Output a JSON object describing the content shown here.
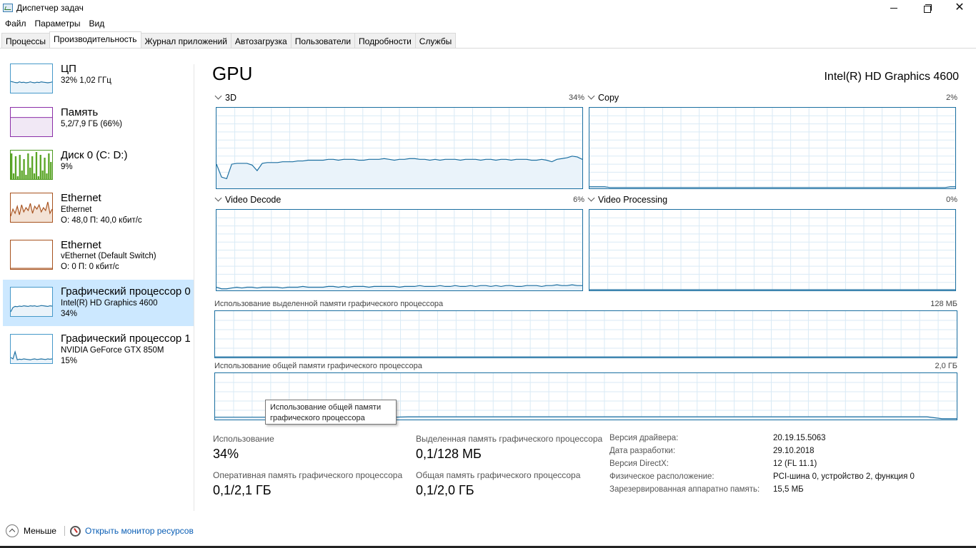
{
  "window": {
    "title": "Диспетчер задач",
    "minimize": "",
    "maximize": "",
    "close": "✕"
  },
  "menu": [
    "Файл",
    "Параметры",
    "Вид"
  ],
  "tabs": [
    "Процессы",
    "Производительность",
    "Журнал приложений",
    "Автозагрузка",
    "Пользователи",
    "Подробности",
    "Службы"
  ],
  "active_tab": "Производительность",
  "sidebar": [
    {
      "title": "ЦП",
      "line1": "32% 1,02 ГГц",
      "line2": "",
      "color": "#1a6ea0",
      "fill": "#eaf3fa"
    },
    {
      "title": "Память",
      "line1": "5,2/7,9 ГБ (66%)",
      "line2": "",
      "color": "#8b2fa8",
      "fill": "#f1e8f5",
      "level": 0.66
    },
    {
      "title": "Диск 0 (C: D:)",
      "line1": "9%",
      "line2": "",
      "color": "#4d9a1e",
      "fill": "#5aa526"
    },
    {
      "title": "Ethernet",
      "line1": "Ethernet",
      "line2": "О: 48,0  П: 40,0 кбит/с",
      "color": "#a7521e",
      "fill": "#f3e2d5"
    },
    {
      "title": "Ethernet",
      "line1": "vEthernet (Default Switch)",
      "line2": "О: 0  П: 0 кбит/с",
      "color": "#a7521e",
      "fill": "#ffffff"
    },
    {
      "title": "Графический процессор 0",
      "line1": "Intel(R) HD Graphics 4600",
      "line2": "34%",
      "color": "#1a6ea0",
      "fill": "#eaf3fa",
      "selected": true
    },
    {
      "title": "Графический процессор 1",
      "line1": "NVIDIA GeForce GTX 850M",
      "line2": "15%",
      "color": "#1a6ea0",
      "fill": "#eaf3fa"
    }
  ],
  "main": {
    "title": "GPU",
    "device": "Intel(R) HD Graphics 4600",
    "engines": [
      {
        "name": "3D",
        "percent": "34%",
        "values": [
          30,
          14,
          12,
          30,
          31,
          31,
          31,
          29,
          22,
          31,
          32,
          32,
          32,
          33,
          33,
          33,
          34,
          34,
          35,
          35,
          35,
          35,
          36,
          36,
          35,
          36,
          36,
          36,
          35,
          35,
          36,
          36,
          36,
          37,
          36,
          35,
          36,
          36,
          37,
          37,
          36,
          36,
          35,
          36,
          35,
          36,
          36,
          36,
          35,
          36,
          36,
          36,
          35,
          36,
          36,
          35,
          36,
          36,
          35,
          36,
          36,
          36,
          35,
          35,
          36,
          35,
          33,
          36,
          37,
          38,
          40,
          39,
          36
        ]
      },
      {
        "name": "Copy",
        "percent": "2%",
        "values": [
          2,
          2,
          2,
          2,
          1,
          1,
          1,
          1,
          1,
          1,
          1,
          1,
          1,
          1,
          1,
          1,
          1,
          1,
          1,
          1,
          1,
          1,
          1,
          1,
          1,
          1,
          1,
          1,
          1,
          1,
          1,
          1,
          1,
          1,
          1,
          1,
          1,
          1,
          1,
          1,
          1,
          1,
          1,
          1,
          1,
          1,
          1,
          1,
          1,
          1,
          1,
          1,
          1,
          1,
          1,
          1,
          1,
          1,
          1,
          1,
          1,
          1,
          1,
          1,
          1,
          1,
          1,
          1,
          1,
          1,
          1,
          2,
          2
        ]
      },
      {
        "name": "Video Decode",
        "percent": "6%",
        "values": [
          4,
          2,
          2,
          3,
          4,
          3,
          4,
          4,
          3,
          4,
          4,
          4,
          4,
          3,
          4,
          4,
          4,
          5,
          4,
          4,
          4,
          4,
          5,
          5,
          4,
          5,
          4,
          5,
          5,
          5,
          4,
          5,
          5,
          5,
          5,
          5,
          4,
          5,
          5,
          5,
          6,
          5,
          5,
          5,
          6,
          5,
          5,
          6,
          5,
          5,
          6,
          5,
          6,
          6,
          5,
          6,
          5,
          6,
          6,
          5,
          5,
          6,
          6,
          6,
          5,
          6,
          6,
          7,
          6,
          6,
          7,
          6,
          6
        ]
      },
      {
        "name": "Video Processing",
        "percent": "0%",
        "values": [
          0,
          0,
          0,
          0,
          0,
          0,
          0,
          0,
          0,
          0,
          0,
          0,
          0,
          0,
          0,
          0,
          0,
          0,
          0,
          0,
          0,
          0,
          0,
          0,
          0,
          0,
          0,
          0,
          0,
          0,
          0,
          0,
          0,
          0,
          0,
          0,
          0,
          0,
          0,
          0,
          0,
          0,
          0,
          0,
          0,
          0,
          0,
          0,
          0,
          0,
          0,
          0,
          0,
          0,
          0,
          0,
          0,
          0,
          0,
          0,
          0,
          0,
          0,
          0,
          0,
          0,
          0,
          0,
          0,
          0,
          0,
          0,
          0
        ]
      }
    ],
    "dedicated": {
      "label": "Использование выделенной памяти графического процессора",
      "max": "128 МБ",
      "values": [
        0,
        0,
        0,
        0,
        0,
        0,
        0,
        0,
        0,
        0,
        0,
        0,
        0,
        0,
        0,
        0,
        0,
        0,
        0,
        0,
        0,
        0,
        0,
        0
      ]
    },
    "shared": {
      "label": "Использование общей памяти графического процессора",
      "max": "2,0 ГБ",
      "values": [
        5,
        5,
        5,
        5,
        5,
        5,
        5,
        5,
        5,
        5,
        5,
        5,
        5,
        6,
        6,
        6,
        6,
        6,
        6,
        6,
        6,
        6,
        6,
        6,
        6,
        6,
        6,
        6,
        6,
        6,
        6,
        6,
        6,
        6,
        6,
        6,
        6,
        6,
        6,
        6,
        6,
        6,
        6,
        6,
        6,
        6,
        6,
        6,
        6,
        2,
        2
      ]
    },
    "tooltip": "Использование общей памяти графического процессора"
  },
  "stats": {
    "usage": {
      "label": "Использование",
      "value": "34%"
    },
    "dedicated": {
      "label": "Выделенная память графического процессора",
      "value": "0,1/128 МБ"
    },
    "ram": {
      "label": "Оперативная память графического процессора",
      "value": "0,1/2,1 ГБ"
    },
    "shared": {
      "label": "Общая память графического процессора",
      "value": "0,1/2,0 ГБ"
    }
  },
  "info": [
    {
      "label": "Версия драйвера:",
      "value": "20.19.15.5063"
    },
    {
      "label": "Дата разработки:",
      "value": "29.10.2018"
    },
    {
      "label": "Версия DirectX:",
      "value": "12 (FL 11.1)"
    },
    {
      "label": "Физическое расположение:",
      "value": "PCI-шина 0, устройство 2, функция 0"
    },
    {
      "label": "Зарезервированная аппаратно память:",
      "value": "15,5 МБ"
    }
  ],
  "footer": {
    "less": "Меньше",
    "resmon": "Открыть монитор ресурсов"
  }
}
